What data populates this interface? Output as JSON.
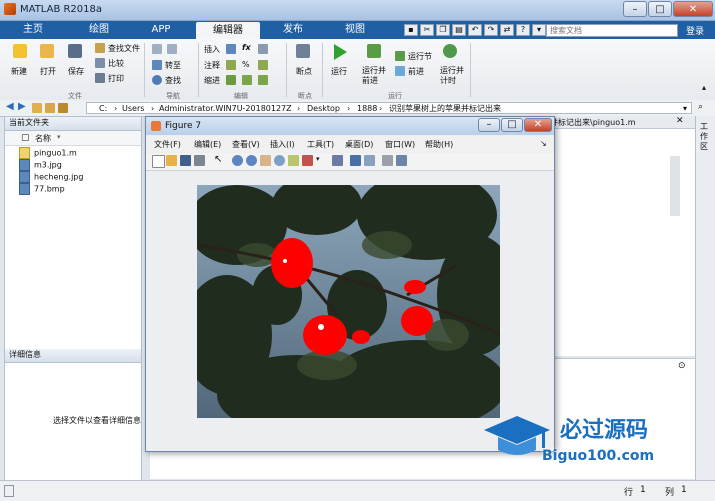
{
  "window": {
    "title": "MATLAB R2018a"
  },
  "tabs": [
    {
      "label": "主页"
    },
    {
      "label": "绘图"
    },
    {
      "label": "APP"
    },
    {
      "label": "编辑器"
    },
    {
      "label": "发布"
    },
    {
      "label": "视图"
    }
  ],
  "active_tab": "编辑器",
  "search": {
    "placeholder": "搜索文档"
  },
  "login_label": "登录",
  "ribbon": {
    "new": "新建",
    "open": "打开",
    "save": "保存",
    "find_files": "查找文件",
    "compare": "比较",
    "print": "打印",
    "goto": "转至",
    "find": "查找",
    "insert": "插入",
    "comment": "注释",
    "indent": "缩进",
    "fx": "fx",
    "breakpoint": "断点",
    "run": "运行",
    "run_advance": "运行并前进",
    "run_section": "运行节",
    "advance": "前进",
    "run_time": "运行并计时",
    "groups": {
      "file": "文件",
      "navigate": "导航",
      "edit": "编辑",
      "breakpoints": "断点",
      "run": "运行"
    }
  },
  "address": {
    "segments": [
      "C:",
      "Users",
      "Administrator.WIN7U-20180127Z",
      "Desktop",
      "1888",
      "识别苹果树上的苹果并标记出来"
    ]
  },
  "left_panel": {
    "title": "当前文件夹",
    "column": "名称",
    "files": [
      {
        "name": "pinguo1.m",
        "type": "m"
      },
      {
        "name": "m3.jpg",
        "type": "img"
      },
      {
        "name": "hecheng.jpg",
        "type": "img"
      },
      {
        "name": "77.bmp",
        "type": "img"
      }
    ],
    "details_title": "详细信息",
    "details_hint": "选择文件以查看详细信息"
  },
  "editor_path_fragment": "并标记出来\\pinguo1.m",
  "workspace_tab": "工作区",
  "figure": {
    "title": "Figure 7",
    "menu": [
      "文件(F)",
      "编辑(E)",
      "查看(V)",
      "插入(I)",
      "工具(T)",
      "桌面(D)",
      "窗口(W)",
      "帮助(H)"
    ]
  },
  "status": {
    "row_label": "行",
    "row": "1",
    "col_label": "列",
    "col": "1"
  },
  "watermark": {
    "title": "必过源码",
    "url": "Biguo100.com"
  },
  "colors": {
    "tab_bar": "#1f5fa4",
    "apple_mark": "#ff0000",
    "sky": "#7d97ad",
    "foliage": "#1f2c1e"
  }
}
